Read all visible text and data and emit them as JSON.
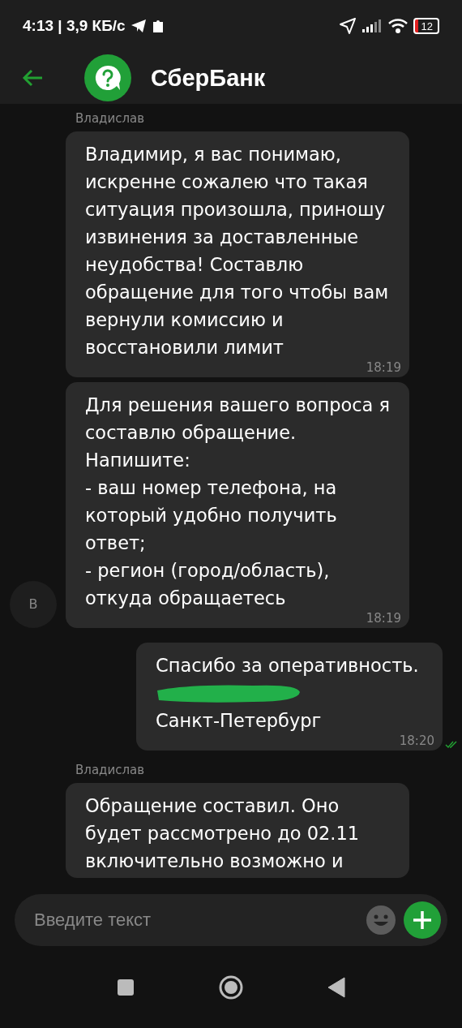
{
  "status_bar": {
    "time": "4:13 | 3,9 КБ/с",
    "battery": "12"
  },
  "header": {
    "title": "СберБанк"
  },
  "messages": [
    {
      "kind": "incoming",
      "sender": "Владислав",
      "text": "Владимир, я вас понимаю, искренне сожалею что такая ситуация произошла, приношу извинения за доставленные неудобства! Составлю обращение для того чтобы вам вернули комиссию и восстановили лимит",
      "time": "18:19"
    },
    {
      "kind": "incoming",
      "avatar": "В",
      "text": "Для решения вашего вопроса я составлю обращение.\nНапишите:\n- ваш номер телефона, на который удобно получить ответ;\n- регион (город/область), откуда обращаетесь",
      "time": "18:19"
    },
    {
      "kind": "outgoing",
      "parts": [
        {
          "kind": "text",
          "text": "Спасибо за оперативность."
        },
        {
          "kind": "redaction"
        },
        {
          "kind": "text",
          "text": "Санкт-Петербург"
        }
      ],
      "time": "18:20",
      "read": true
    },
    {
      "kind": "incoming",
      "sender": "Владислав",
      "text": "Обращение составил. Оно будет рассмотрено до 02.11 включительно возможно и"
    }
  ],
  "composer": {
    "placeholder": "Введите текст"
  }
}
